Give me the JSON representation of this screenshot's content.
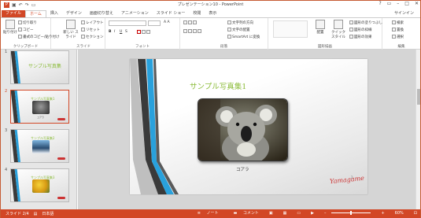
{
  "window": {
    "title": "プレゼンテーション10 - PowerPoint",
    "min": "–",
    "max": "□",
    "close": "✕",
    "help": "?"
  },
  "quick_access": [
    "save-icon",
    "undo-icon",
    "redo-icon",
    "present-icon"
  ],
  "tabs": [
    "ファイル",
    "ホーム",
    "挿入",
    "デザイン",
    "画面切り替え",
    "アニメーション",
    "スライド ショー",
    "校閲",
    "表示"
  ],
  "signin": "サインイン",
  "ribbon": {
    "clipboard": {
      "paste": "貼り付け",
      "cut": "切り取り",
      "copy": "コピー",
      "format_painter": "書式のコピー/貼り付け",
      "label": "クリップボード"
    },
    "slides": {
      "new_slide": "新しい スライド",
      "layout": "レイアウト",
      "reset": "リセット",
      "section": "セクション",
      "label": "スライド"
    },
    "font": {
      "bold": "B",
      "italic": "I",
      "underline": "U",
      "strike": "S",
      "label": "フォント"
    },
    "paragraph": {
      "direction": "文字列の方向",
      "align_text": "文字の配置",
      "smartart": "SmartArt に変換",
      "label": "段落"
    },
    "drawing": {
      "arrange": "配置",
      "quick_styles": "クイック スタイル",
      "fill": "図形の塗りつぶし",
      "outline": "図形の枠線",
      "effects": "図形の効果",
      "label": "図形描画"
    },
    "editing": {
      "find": "検索",
      "replace": "置換",
      "select": "選択",
      "label": "編集"
    }
  },
  "thumbnails": [
    {
      "num": "1",
      "title": "サンプル写真集",
      "selected": false
    },
    {
      "num": "2",
      "title": "サンプル写真集1",
      "selected": true,
      "caption": "コアラ"
    },
    {
      "num": "3",
      "title": "サンプル写真集2",
      "selected": false
    },
    {
      "num": "4",
      "title": "サンプル写真集3",
      "selected": false
    }
  ],
  "slide": {
    "title": "サンプル写真集1",
    "caption": "コアラ",
    "signature": "Yamagame",
    "number": "2"
  },
  "status": {
    "slide_pos": "スライド 2/4",
    "language": "日本語",
    "notes": "ノート",
    "comments": "コメント",
    "zoom": "60%"
  },
  "colors": {
    "accent": "#d24726",
    "title_green": "#8cbc3a",
    "stripe_blue": "#29a1dc",
    "stripe_dark": "#3a3a3a"
  }
}
